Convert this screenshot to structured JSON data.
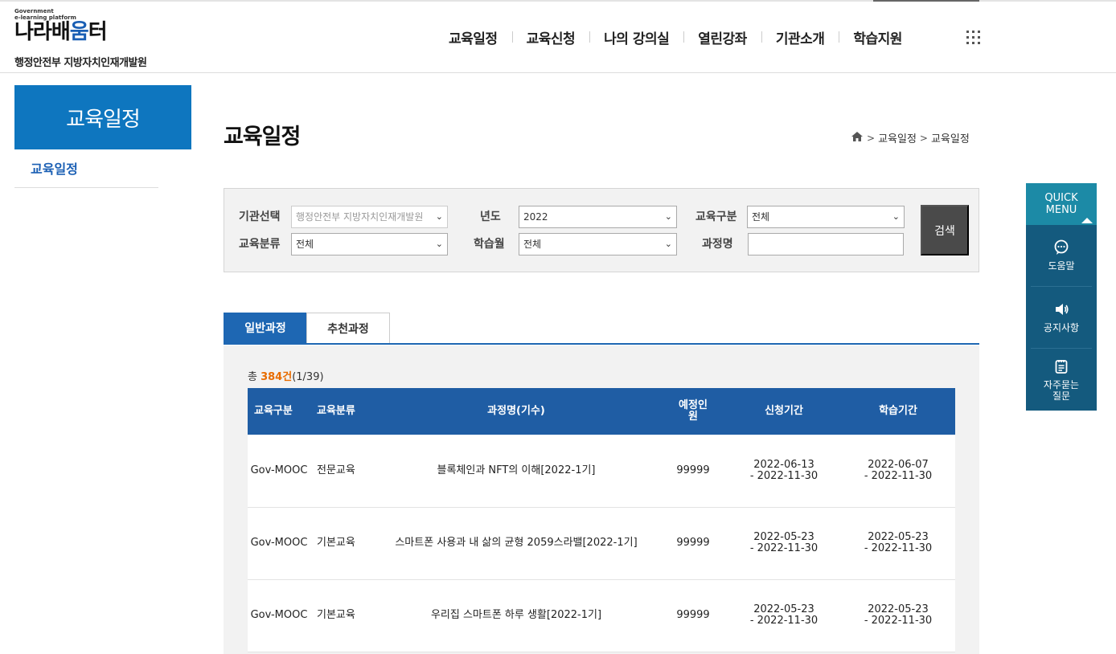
{
  "header": {
    "logo_gov": "Government\ne-learning platform",
    "logo_name_a": "나라배",
    "logo_name_b": "움",
    "logo_name_c": "터",
    "org": "행정안전부 지방자치인재개발원",
    "nav": [
      "교육일정",
      "교육신청",
      "나의 강의실",
      "열린강좌",
      "기관소개",
      "학습지원"
    ]
  },
  "sidebar": {
    "title": "교육일정",
    "items": [
      {
        "label": "교육일정"
      }
    ]
  },
  "main": {
    "title": "교육일정",
    "breadcrumb": [
      "교육일정",
      "교육일정"
    ]
  },
  "search": {
    "inst_label": "기관선택",
    "inst_value": "행정안전부 지방자치인재개발원",
    "year_label": "년도",
    "year_value": "2022",
    "type_label": "교육구분",
    "type_value": "전체",
    "cls_label": "교육분류",
    "cls_value": "전체",
    "month_label": "학습월",
    "month_value": "전체",
    "course_label": "과정명",
    "course_value": "",
    "button": "검색"
  },
  "tabs": [
    "일반과정",
    "추천과정"
  ],
  "list": {
    "total_prefix": "총 ",
    "total_count": "384건",
    "total_page": "(1/39)",
    "headers": [
      "교육구분",
      "교육분류",
      "과정명(기수)",
      "예정인원",
      "신청기간",
      "학습기간"
    ],
    "rows": [
      {
        "category": "Gov-MOOC",
        "class": "전문교육",
        "course": "블록체인과 NFT의 이해[2022-1기]",
        "capacity": "99999",
        "apply": "2022-06-13\n- 2022-11-30",
        "study": "2022-06-07\n- 2022-11-30"
      },
      {
        "category": "Gov-MOOC",
        "class": "기본교육",
        "course": "스마트폰 사용과 내 삶의 균형 2059스라밸[2022-1기]",
        "capacity": "99999",
        "apply": "2022-05-23\n- 2022-11-30",
        "study": "2022-05-23\n- 2022-11-30"
      },
      {
        "category": "Gov-MOOC",
        "class": "기본교육",
        "course": "우리집 스마트폰 하루 생활[2022-1기]",
        "capacity": "99999",
        "apply": "2022-05-23\n- 2022-11-30",
        "study": "2022-05-23\n- 2022-11-30"
      }
    ]
  },
  "quick_menu": {
    "title": "QUICK\nMENU",
    "items": [
      {
        "label": "도움말",
        "icon": "help-chat-icon"
      },
      {
        "label": "공지사항",
        "icon": "speaker-icon"
      },
      {
        "label": "자주묻는\n질문",
        "icon": "faq-note-icon"
      }
    ]
  },
  "colors": {
    "brand_blue": "#0e76bf",
    "table_header": "#1f5da4",
    "count_orange": "#e86c00",
    "quick_bg": "#145a7e",
    "quick_head": "#1c8aa6"
  }
}
